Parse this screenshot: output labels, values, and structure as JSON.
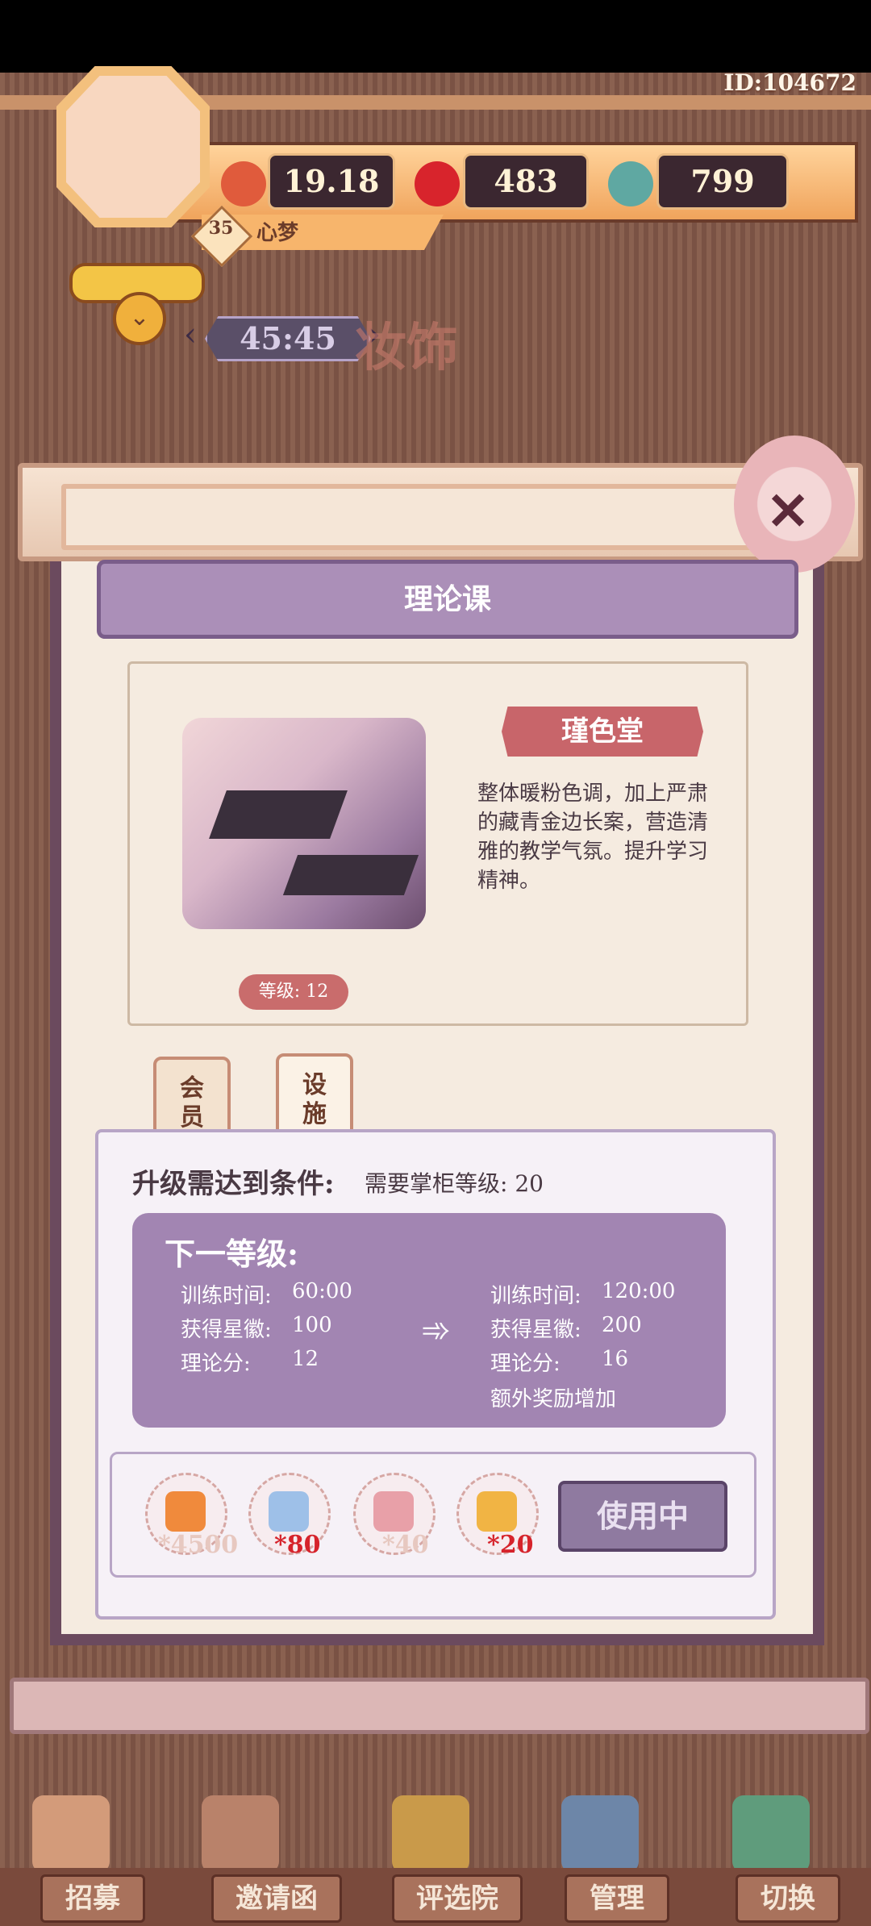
{
  "player": {
    "id": "ID:104672",
    "level": "35",
    "name": "心梦"
  },
  "resources": {
    "coins": "19.18万",
    "gems": "483",
    "jade": "799"
  },
  "timer": "45:45",
  "background_sign": "妆饰",
  "panel": {
    "title": "理论课",
    "facility_name": "瑾色堂",
    "description": "整体暖粉色调，加上严肃的藏青金边长案，营造清雅的教学气氛。提升学习精神。",
    "level_label": "等级: 12",
    "tabs": [
      {
        "label": "会员"
      },
      {
        "label": "设施"
      }
    ],
    "upgrade_condition_label": "升级需达到条件:",
    "upgrade_condition_value": "需要掌柜等级: 20",
    "next_level_label": "下一等级:",
    "current": {
      "train_time_label": "训练时间:",
      "train_time": "60:00",
      "stars_label": "获得星徽:",
      "stars": "100",
      "theory_label": "理论分:",
      "theory": "12"
    },
    "next": {
      "train_time_label": "训练时间:",
      "train_time": "120:00",
      "stars_label": "获得星徽:",
      "stars": "200",
      "theory_label": "理论分:",
      "theory": "16",
      "extra": "额外奖励增加"
    },
    "costs": [
      {
        "value": "*4500",
        "color": "#e7c8c0"
      },
      {
        "value": "*80",
        "color": "#d6232b"
      },
      {
        "value": "*40",
        "color": "#e7c8c0"
      },
      {
        "value": "*20",
        "color": "#d6232b"
      }
    ],
    "use_button": "使用中"
  },
  "bottom_nav": [
    {
      "label": "招募"
    },
    {
      "label": "邀请函"
    },
    {
      "label": "评选院"
    },
    {
      "label": "管理"
    },
    {
      "label": "切换"
    }
  ]
}
